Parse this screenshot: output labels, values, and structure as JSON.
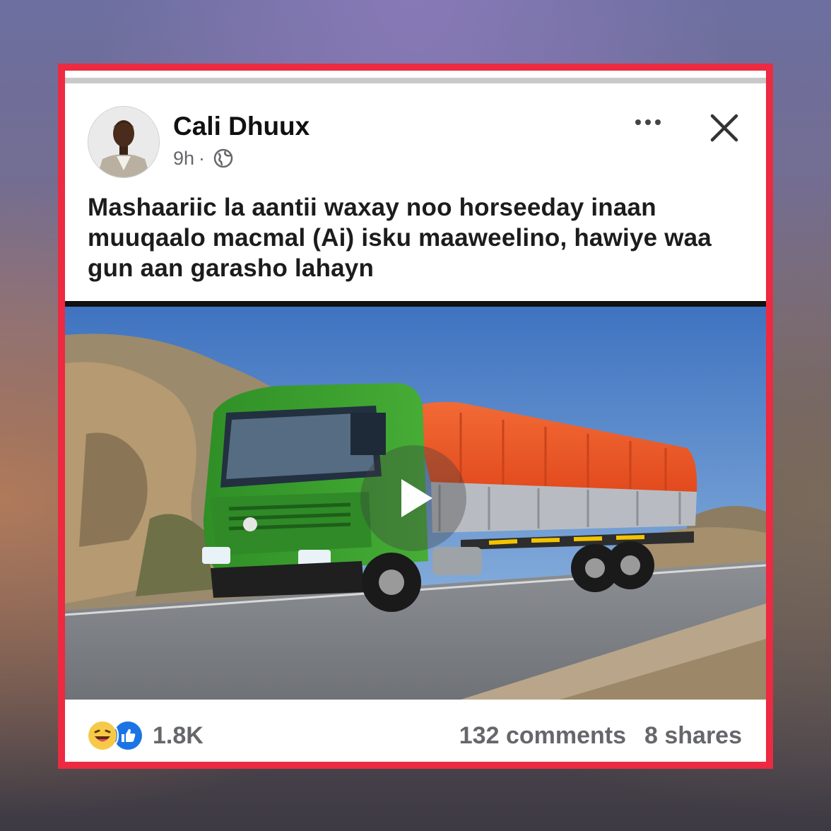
{
  "post": {
    "author": "Cali Dhuux",
    "time": "9h",
    "separator": "·",
    "text": "Mashaariic la aantii waxay noo horseeday inaan muuqaalo macmal (Ai) isku maaweelino, hawiye waa gun aan garasho lahayn",
    "icons": {
      "privacy": "globe-icon",
      "menu": "more-options-icon",
      "close": "close-icon",
      "play": "play-icon",
      "reaction_1": "haha-reaction-icon",
      "reaction_2": "like-reaction-icon"
    }
  },
  "engagement": {
    "reactions": "1.8K",
    "comments": "132 comments",
    "shares": "8 shares"
  },
  "colors": {
    "frame": "#ec2a41",
    "truck_cab": "#3a9b2e",
    "tarp": "#f05a2a",
    "sky": "#4a7fc8"
  }
}
